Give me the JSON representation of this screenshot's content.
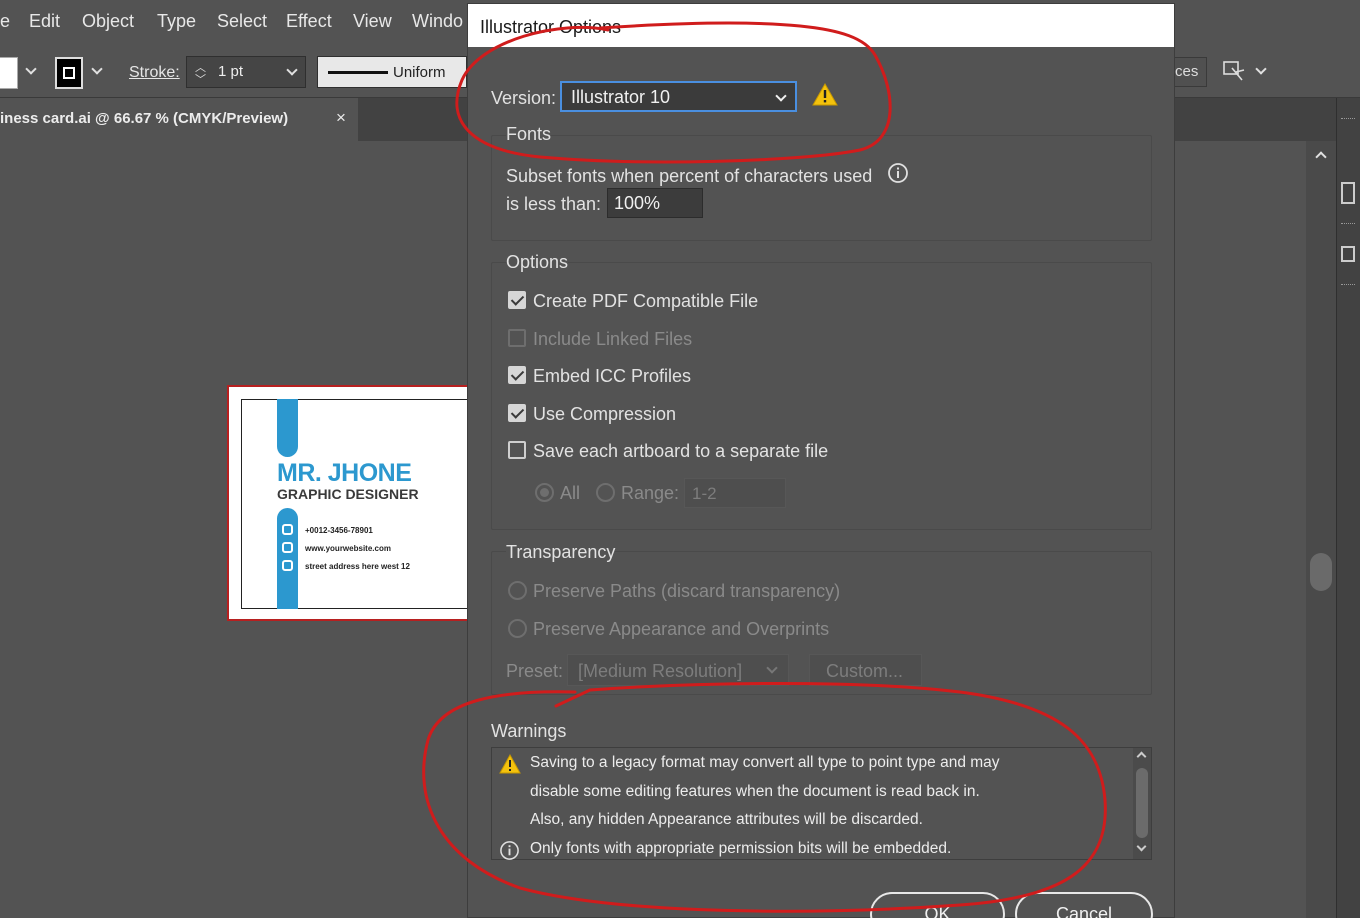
{
  "menubar": {
    "items": [
      "e",
      "Edit",
      "Object",
      "Type",
      "Select",
      "Effect",
      "View",
      "Windo"
    ]
  },
  "control_bar": {
    "stroke_label": "Stroke:",
    "stroke_weight": "1 pt",
    "stroke_profile": "Uniform",
    "right_partial_label": "ces"
  },
  "document_tab": {
    "title": "iness card.ai @ 66.67 % (CMYK/Preview)",
    "close": "×"
  },
  "card": {
    "name": "MR. JHONE",
    "role": "GRAPHIC DESIGNER",
    "phone": "+0012-3456-78901",
    "website": "www.yourwebsite.com",
    "address": "street address here west 12",
    "accent_color": "#2c98cf"
  },
  "dialog": {
    "title": "Illustrator Options",
    "version": {
      "label": "Version:",
      "value": "Illustrator 10",
      "warning_icon": "warning-icon"
    },
    "fonts": {
      "title": "Fonts",
      "subset_line1": "Subset fonts when percent of characters used",
      "subset_line2": "is less than:",
      "subset_value": "100%"
    },
    "options": {
      "title": "Options",
      "create_pdf": {
        "label": "Create PDF Compatible File",
        "checked": true
      },
      "include_linked": {
        "label": "Include Linked Files",
        "checked": false,
        "disabled": true
      },
      "embed_icc": {
        "label": "Embed ICC Profiles",
        "checked": true
      },
      "use_compression": {
        "label": "Use Compression",
        "checked": true
      },
      "save_each_artboard": {
        "label": "Save each artboard to a separate file",
        "checked": false
      },
      "all_label": "All",
      "range_label": "Range:",
      "range_value": "1-2"
    },
    "transparency": {
      "title": "Transparency",
      "preserve_paths": "Preserve Paths (discard transparency)",
      "preserve_appearance": "Preserve Appearance and Overprints",
      "preset_label": "Preset:",
      "preset_value": "[Medium Resolution]",
      "custom_button": "Custom..."
    },
    "warnings": {
      "title": "Warnings",
      "line1": "Saving to a legacy format may convert all type to point type and may",
      "line2": "disable some editing features when the document is read back in.",
      "line3": "Also, any hidden Appearance attributes will be discarded.",
      "line4": "Only fonts with appropriate permission bits will be embedded."
    },
    "ok_button": "OK",
    "cancel_button": "Cancel"
  },
  "colors": {
    "annotation_red": "#d01c1c",
    "warning_yellow": "#f4c20d",
    "focus_blue": "#4a8fe0"
  }
}
